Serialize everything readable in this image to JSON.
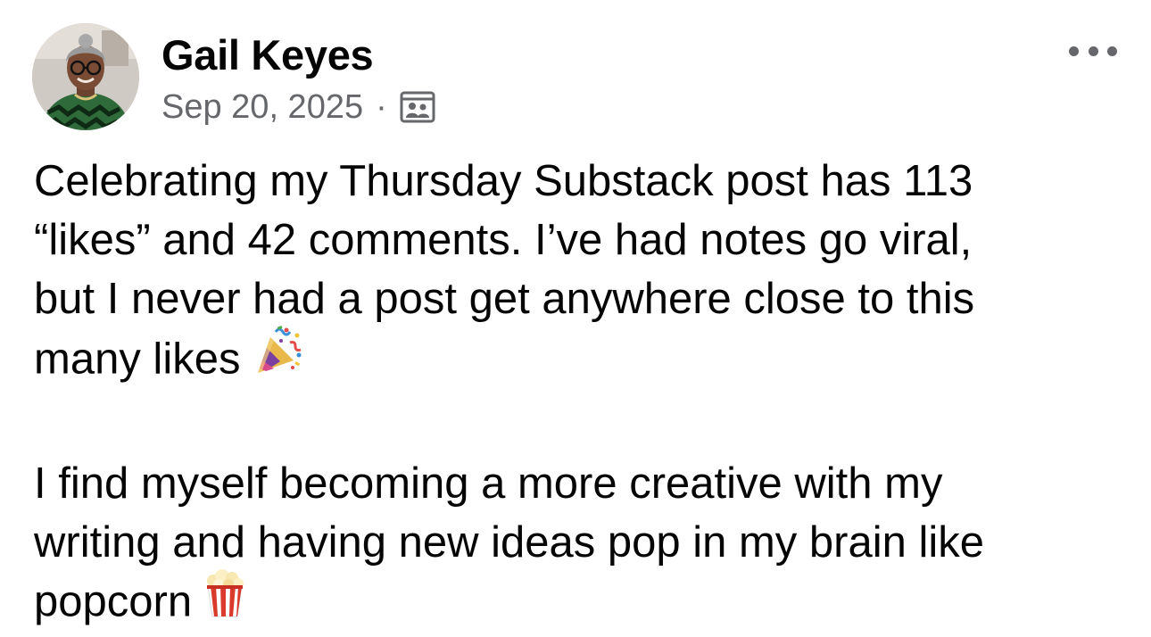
{
  "author": {
    "name": "Gail Keyes"
  },
  "meta": {
    "date": "Sep 20, 2025",
    "separator": "·",
    "audience_icon": "audience-icon"
  },
  "menu": {
    "more_icon": "more-horizontal-icon"
  },
  "post": {
    "paragraph1_line1": "Celebrating my Thursday Substack post has 113",
    "paragraph1_line2": "“likes” and 42 comments. I’ve had notes go viral,",
    "paragraph1_line3": "but I never had a post get anywhere close to this",
    "paragraph1_line4": "many likes",
    "paragraph1_emoji": "party-popper-emoji",
    "paragraph2_line1": "I find myself becoming a more creative with my",
    "paragraph2_line2": "writing and having new ideas pop in my brain like",
    "paragraph2_line3": "popcorn",
    "paragraph2_emoji": "popcorn-emoji"
  },
  "colors": {
    "text": "#050505",
    "secondary_text": "#65676b",
    "background": "#ffffff"
  }
}
